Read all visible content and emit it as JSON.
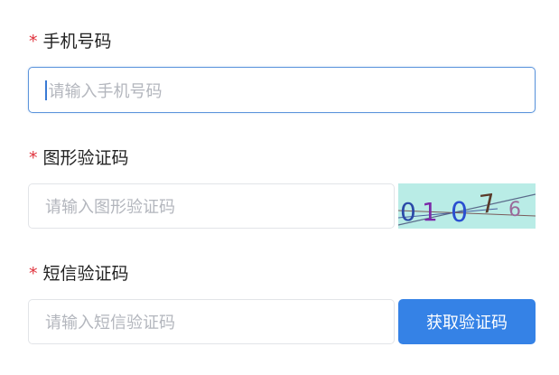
{
  "form": {
    "required_mark": "*",
    "phone": {
      "label": "手机号码",
      "placeholder": "请输入手机号码"
    },
    "captcha": {
      "label": "图形验证码",
      "placeholder": "请输入图形验证码",
      "image_text": [
        "0",
        "1",
        "0",
        "7",
        "6"
      ]
    },
    "sms": {
      "label": "短信验证码",
      "placeholder": "请输入短信验证码",
      "button_label": "获取验证码"
    }
  },
  "colors": {
    "required": "#e0323c",
    "accent": "#3582e6",
    "captcha_background": "#b9ece6"
  }
}
